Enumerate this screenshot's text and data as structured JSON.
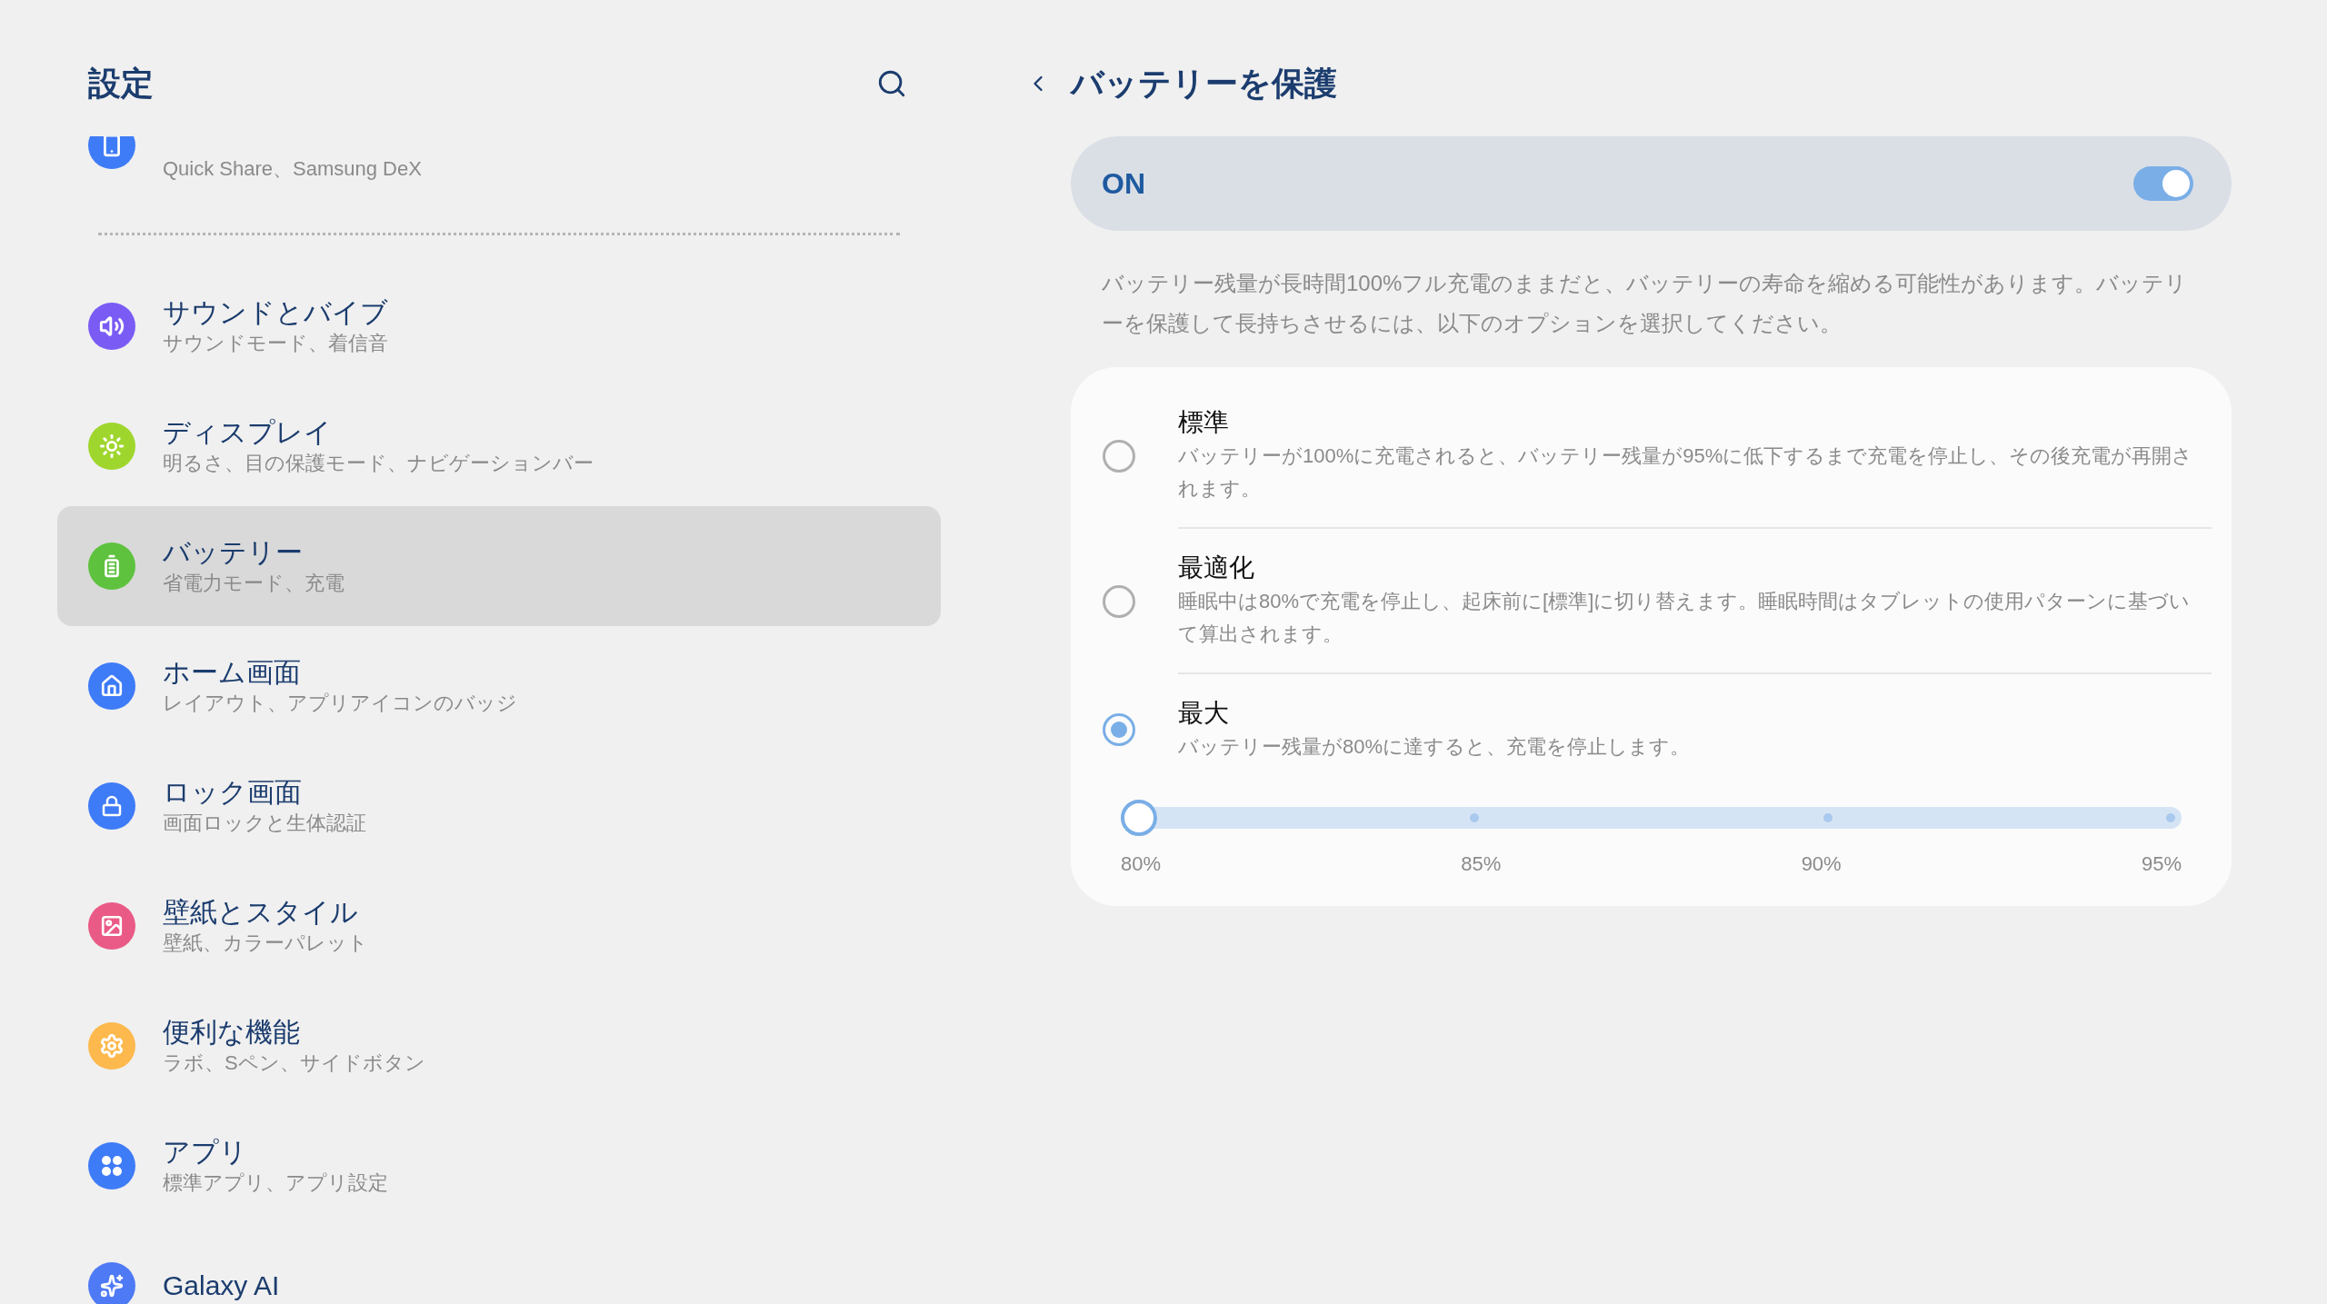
{
  "sidebar": {
    "title": "設定",
    "items": [
      {
        "kind": "partial",
        "subtitle": "Quick Share、Samsung DeX",
        "color": "#3e7bf7",
        "selected": false
      },
      {
        "kind": "divider"
      },
      {
        "kind": "item",
        "title": "サウンドとバイブ",
        "subtitle": "サウンドモード、着信音",
        "color": "#7a5cf5",
        "selected": false
      },
      {
        "kind": "item",
        "title": "ディスプレイ",
        "subtitle": "明るさ、目の保護モード、ナビゲーションバー",
        "color": "#9fd62d",
        "selected": false
      },
      {
        "kind": "item",
        "title": "バッテリー",
        "subtitle": "省電力モード、充電",
        "color": "#5ec23e",
        "selected": true
      },
      {
        "kind": "item",
        "title": "ホーム画面",
        "subtitle": "レイアウト、アプリアイコンのバッジ",
        "color": "#3e7bf7",
        "selected": false
      },
      {
        "kind": "item",
        "title": "ロック画面",
        "subtitle": "画面ロックと生体認証",
        "color": "#3e7bf7",
        "selected": false
      },
      {
        "kind": "item",
        "title": "壁紙とスタイル",
        "subtitle": "壁紙、カラーパレット",
        "color": "#ea5a86",
        "selected": false
      },
      {
        "kind": "item",
        "title": "便利な機能",
        "subtitle": "ラボ、Sペン、サイドボタン",
        "color": "#fdb94d",
        "selected": false
      },
      {
        "kind": "item",
        "title": "アプリ",
        "subtitle": "標準アプリ、アプリ設定",
        "color": "#3e7bf7",
        "selected": false
      },
      {
        "kind": "item",
        "title": "Galaxy AI",
        "color": "#4f7af5",
        "selected": false
      }
    ]
  },
  "detail": {
    "title": "バッテリーを保護",
    "master": {
      "label": "ON",
      "on": true
    },
    "description": "バッテリー残量が長時間100%フル充電のままだと、バッテリーの寿命を縮める可能性があります。バッテリーを保護して長持ちさせるには、以下のオプションを選択してください。",
    "options": [
      {
        "title": "標準",
        "description": "バッテリーが100%に充電されると、バッテリー残量が95%に低下するまで充電を停止し、その後充電が再開されます。",
        "selected": false
      },
      {
        "title": "最適化",
        "description": "睡眠中は80%で充電を停止し、起床前に[標準]に切り替えます。睡眠時間はタブレットの使用パターンに基づいて算出されます。",
        "selected": false
      },
      {
        "title": "最大",
        "description": "バッテリー残量が80%に達すると、充電を停止します。",
        "selected": true
      }
    ],
    "slider": {
      "level": 0,
      "ticks": [
        "80%",
        "85%",
        "90%",
        "95%"
      ]
    }
  }
}
